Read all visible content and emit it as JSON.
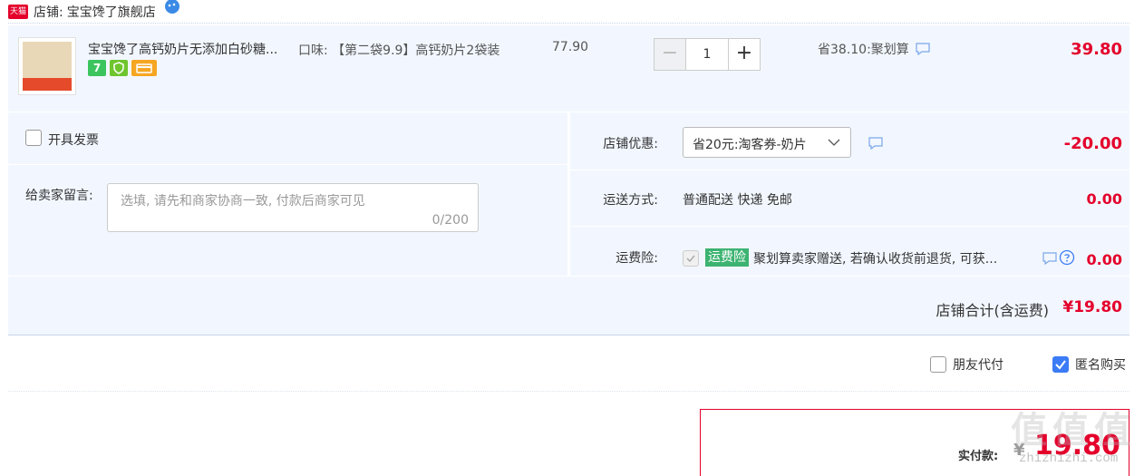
{
  "store": {
    "badge": "天猫",
    "label": "店铺:",
    "name": "宝宝馋了旗舰店"
  },
  "item": {
    "title": "宝宝馋了高钙奶片无添加白砂糖...",
    "tags": [
      "7",
      "",
      ""
    ],
    "sku": "口味: 【第二袋9.9】高钙奶片2袋装",
    "unit_price": "77.90",
    "quantity": "1",
    "minus_label": "−",
    "plus_label": "+",
    "discount": "省38.10:聚划算",
    "total": "39.80"
  },
  "invoice": {
    "label": "开具发票"
  },
  "memo": {
    "label": "给卖家留言:",
    "placeholder": "选填, 请先和商家协商一致, 付款后商家可见",
    "counter": "0/200"
  },
  "coupon": {
    "label": "店铺优惠:",
    "selected": "省20元:淘客券-奶片",
    "amount": "-20.00"
  },
  "shipping": {
    "label": "运送方式:",
    "value": "普通配送 快递 免邮",
    "amount": "0.00"
  },
  "insurance": {
    "label": "运费险:",
    "badge": "运费险",
    "text": "聚划算卖家赠送, 若确认收货前退货, 可获...",
    "amount": "0.00"
  },
  "store_total": {
    "label": "店铺合计(含运费)",
    "amount": "¥19.80"
  },
  "options": {
    "friend_pay": "朋友代付",
    "anonymous": "匿名购买"
  },
  "payment": {
    "label": "实付款:",
    "yen": "¥",
    "amount": "19.80"
  },
  "watermark": {
    "main": "值值值",
    "sub": "zhizhizhi.com"
  },
  "colors": {
    "price_red": "#e4002b",
    "panel_bg": "#f2f7ff",
    "checkbox_blue": "#3b7bf6",
    "insurance_green": "#3cb371"
  }
}
